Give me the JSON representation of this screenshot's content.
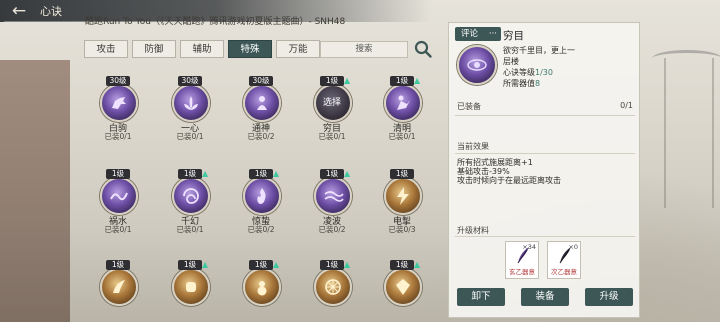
{
  "header": {
    "back_label": "←",
    "title": "心诀",
    "marquee": "酷跑Run To You（《天天酷跑》腾讯游戏初夏版主题曲）- SNH48"
  },
  "tabs": [
    {
      "label": "攻击",
      "active": false
    },
    {
      "label": "防御",
      "active": false
    },
    {
      "label": "辅助",
      "active": false
    },
    {
      "label": "特殊",
      "active": true
    },
    {
      "label": "万能",
      "active": false
    }
  ],
  "search": {
    "label": "搜索"
  },
  "skills": [
    {
      "name": "白驹",
      "level": "30级",
      "equipped": "已装0/1",
      "icon": "horse-icon",
      "style": "purple",
      "upgradable": false
    },
    {
      "name": "一心",
      "level": "30级",
      "equipped": "已装0/1",
      "icon": "lotus-icon",
      "style": "purple",
      "upgradable": false
    },
    {
      "name": "通神",
      "level": "30级",
      "equipped": "已装0/2",
      "icon": "spirit-icon",
      "style": "purple",
      "upgradable": false
    },
    {
      "name": "穷目",
      "level": "1级",
      "equipped": "已装0/1",
      "icon": "eye-icon",
      "style": "dark",
      "upgradable": true,
      "selected": true,
      "selected_label": "选择"
    },
    {
      "name": "清明",
      "level": "1级",
      "equipped": "已装0/1",
      "icon": "figure-icon",
      "style": "purple",
      "upgradable": true
    },
    {
      "name": "祸水",
      "level": "1级",
      "equipped": "已装0/1",
      "icon": "wave-icon",
      "style": "purple",
      "upgradable": false
    },
    {
      "name": "千幻",
      "level": "1级",
      "equipped": "已装0/1",
      "icon": "swirl-icon",
      "style": "purple",
      "upgradable": true
    },
    {
      "name": "惊蛰",
      "level": "1级",
      "equipped": "已装0/2",
      "icon": "flame-icon",
      "style": "purple",
      "upgradable": true
    },
    {
      "name": "凌波",
      "level": "1级",
      "equipped": "已装0/2",
      "icon": "ripple-icon",
      "style": "purple",
      "upgradable": true
    },
    {
      "name": "电掣",
      "level": "1级",
      "equipped": "已装0/3",
      "icon": "bolt-icon",
      "style": "gold",
      "upgradable": false
    },
    {
      "name": "",
      "level": "1级",
      "equipped": "",
      "icon": "claw-icon",
      "style": "gold",
      "upgradable": false
    },
    {
      "name": "",
      "level": "1级",
      "equipped": "",
      "icon": "fist-icon",
      "style": "gold",
      "upgradable": true
    },
    {
      "name": "",
      "level": "1级",
      "equipped": "",
      "icon": "gourd-icon",
      "style": "gold",
      "upgradable": true
    },
    {
      "name": "",
      "level": "1级",
      "equipped": "",
      "icon": "wheel-icon",
      "style": "gold",
      "upgradable": true
    },
    {
      "name": "",
      "level": "1级",
      "equipped": "",
      "icon": "gem-icon",
      "style": "gold",
      "upgradable": true
    }
  ],
  "detail": {
    "review_label": "评论",
    "review_more": "···",
    "name": "穷目",
    "desc": "欲穷千里目，更上一",
    "desc2": "层楼",
    "level_label": "心诀等级",
    "level_value": "1/30",
    "need_label": "所需器值",
    "need_value": "8",
    "equipped_label": "已装备",
    "equipped_value": "0/1",
    "effect_label": "当前效果",
    "effects": [
      "所有招式施展距离+1",
      "基础攻击-39%",
      "攻击时倾向于在最远距离攻击"
    ],
    "material_label": "升级材料",
    "materials": [
      {
        "name": "玄乙器意",
        "qty": "×34",
        "icon": "feather-icon"
      },
      {
        "name": "次乙器意",
        "qty": "×0",
        "icon": "feather-icon"
      }
    ],
    "buttons": {
      "unequip": "卸下",
      "equip": "装备",
      "upgrade": "升级"
    }
  },
  "colors": {
    "accent": "#3d5756",
    "upgrade_arrow": "#40c9a0"
  }
}
